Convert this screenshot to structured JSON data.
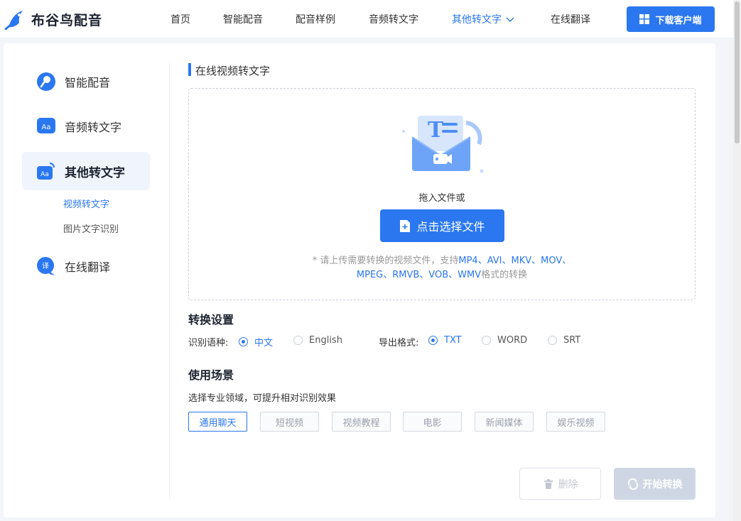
{
  "header": {
    "brand": "布谷鸟配音",
    "nav": [
      "首页",
      "智能配音",
      "配音样例",
      "音频转文字",
      "其他转文字",
      "在线翻译"
    ],
    "active_nav": "其他转文字",
    "download_label": "下载客户端"
  },
  "sidebar": {
    "items": [
      {
        "label": "智能配音",
        "icon": "voice-icon"
      },
      {
        "label": "音频转文字",
        "icon": "aa-icon"
      },
      {
        "label": "其他转文字",
        "icon": "aa-icon",
        "active": true
      },
      {
        "label": "在线翻译",
        "icon": "translate-icon"
      }
    ],
    "sub_items": [
      {
        "label": "视频转文字",
        "active": true
      },
      {
        "label": "图片文字识别",
        "active": false
      }
    ]
  },
  "content": {
    "section_title": "在线视频转文字",
    "drag_text": "拖入文件或",
    "choose_label": "点击选择文件",
    "hint_prefix": "* 请上传需要转换的视频文件，支持",
    "hint_line1_formats": "MP4、AVI、MKV、MOV、",
    "hint_line2_formats": "MPEG、RMVB、VOB、WMV",
    "hint_line2_suffix": "格式的转换",
    "settings_title": "转换设置",
    "language_label": "识别语种:",
    "languages": [
      "中文",
      "English"
    ],
    "selected_language": "中文",
    "format_label": "导出格式:",
    "formats": [
      "TXT",
      "WORD",
      "SRT"
    ],
    "selected_format": "TXT",
    "scene_title": "使用场景",
    "scene_hint": "选择专业领域，可提升相对识别效果",
    "scenes": [
      "通用聊天",
      "短视频",
      "视频教程",
      "电影",
      "新闻媒体",
      "娱乐视频"
    ],
    "selected_scene": "通用聊天",
    "delete_label": "删除",
    "start_label": "开始转换"
  },
  "colors": {
    "accent": "#2a77f0",
    "disabled": "#cfd6e3"
  }
}
